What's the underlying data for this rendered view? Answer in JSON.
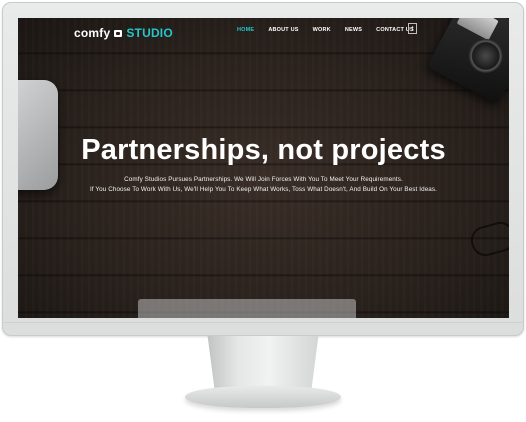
{
  "brand": {
    "name": "comfy",
    "suffix": "STUDIO",
    "accent": "#24c6c8"
  },
  "nav": {
    "items": [
      {
        "label": "HOME",
        "active": true
      },
      {
        "label": "ABOUT US",
        "active": false
      },
      {
        "label": "WORK",
        "active": false
      },
      {
        "label": "NEWS",
        "active": false
      },
      {
        "label": "CONTACT US",
        "active": false
      }
    ],
    "toggle_icon": "facebook-icon",
    "toggle_glyph": "f"
  },
  "hero": {
    "headline": "Partnerships, not projects",
    "line1": "Comfy Studios Pursues Partnerships. We Will Join Forces With You To Meet Your Requirements.",
    "line2": "If You Choose To Work With Us, We'll Help You To Keep What Works, Toss What Doesn't, And Build On Your Best Ideas."
  }
}
